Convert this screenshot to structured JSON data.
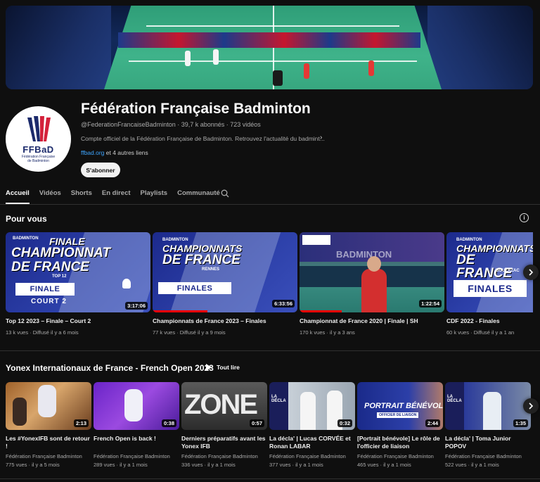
{
  "channel": {
    "title": "Fédération Française Badminton",
    "handle_meta": "@FederationFrancaiseBadminton · 39,7 k abonnés · 723 vidéos",
    "description": "Compte officiel de la Fédération Française de Badminton. Retrouvez l'actualité du badmint...",
    "link_main": "ffbad.org",
    "link_more": " et 4 autres liens",
    "subscribe_label": "S'abonner",
    "avatar_text": "FFBaD",
    "avatar_subtext_1": "Fédération Française",
    "avatar_subtext_2": "de Badminton"
  },
  "tabs": [
    {
      "label": "Accueil",
      "active": true
    },
    {
      "label": "Vidéos"
    },
    {
      "label": "Shorts"
    },
    {
      "label": "En direct"
    },
    {
      "label": "Playlists"
    },
    {
      "label": "Communauté"
    }
  ],
  "for_you": {
    "title": "Pour vous",
    "videos": [
      {
        "title": "Top 12 2023 – Finale – Court 2",
        "stats": "13 k vues · Diffusé il y a 6 mois",
        "duration": "3:17:06",
        "thumb_line1": "FINALE",
        "thumb_line2": "CHAMPIONNAT",
        "thumb_line3": "DE FRANCE",
        "thumb_tag": "TOP 12",
        "thumb_box": "FINALE",
        "thumb_sub": "COURT 2",
        "thumb_brand": "BADMINTON"
      },
      {
        "title": "Championnats de France 2023 – Finales",
        "stats": "77 k vues · Diffusé il y a 9 mois",
        "duration": "6:33:56",
        "thumb_line1": "CHAMPIONNATS",
        "thumb_line2": "DE FRANCE",
        "thumb_tag": "RENNES",
        "thumb_box": "FINALES",
        "thumb_brand": "BADMINTON",
        "progress": 0.38
      },
      {
        "title": "Championnat de France 2020 | Finale | SH",
        "stats": "170 k vues · il y a 3 ans",
        "duration": "1:22:54",
        "thumb_brand": "BADMINTON",
        "progress": 0.29
      },
      {
        "title": "CDF 2022 - Finales",
        "stats": "60 k vues · Diffusé il y a 1 an",
        "thumb_line1": "CHAMPIONNATS",
        "thumb_line2": "DE FRANCE",
        "thumb_tag": "BOULAZAC",
        "thumb_box": "FINALES",
        "thumb_brand": "BADMINTON"
      }
    ]
  },
  "playlist": {
    "title": "Yonex Internationaux de France - French Open 2023",
    "play_all": "Tout lire",
    "videos": [
      {
        "title": "Les #YonexIFB sont de retour !",
        "channel": "Fédération Française Badminton",
        "stats": "775 vues · il y a 5 mois",
        "duration": "2:13"
      },
      {
        "title": "French Open is back !",
        "channel": "Fédération Française Badminton",
        "stats": "289 vues · il y a 1 mois",
        "duration": "0:38"
      },
      {
        "title": "Derniers préparatifs avant les Yonex IFB",
        "channel": "Fédération Française Badminton",
        "stats": "336 vues · il y a 1 mois",
        "duration": "0:57",
        "thumb_text": "ZONE"
      },
      {
        "title": "La décla' | Lucas CORVÉE et Ronan LABAR",
        "channel": "Fédération Française Badminton",
        "stats": "377 vues · il y a 1 mois",
        "duration": "0:32",
        "thumb_text": "LA DÉCLA"
      },
      {
        "title": "[Portrait bénévole] Le rôle de l'officier de liaison",
        "channel": "Fédération Française Badminton",
        "stats": "465 vues · il y a 1 mois",
        "duration": "2:44",
        "thumb_text": "PORTRAIT BÉNÉVOLE",
        "thumb_sub": "OFFICIER DE LIAISON"
      },
      {
        "title": "La décla' | Toma Junior POPOV",
        "channel": "Fédération Française Badminton",
        "stats": "522 vues · il y a 1 mois",
        "duration": "1:35",
        "thumb_text": "LA DÉCLA"
      }
    ]
  }
}
